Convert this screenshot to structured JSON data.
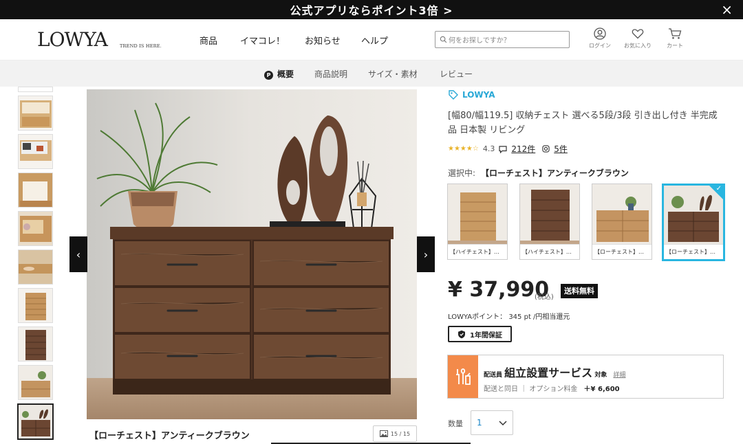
{
  "banner": {
    "text": "公式アプリならポイント3倍 >",
    "close": "×"
  },
  "header": {
    "logo": "LOWYA",
    "logo_sub": "TREND IS HERE.",
    "nav": [
      "商品",
      "イマコレ！",
      "お知らせ",
      "ヘルプ"
    ],
    "search_placeholder": "何をお探しですか？",
    "icons": [
      {
        "label": "ログイン",
        "icon": "user-icon"
      },
      {
        "label": "お気に入り",
        "icon": "heart-icon"
      },
      {
        "label": "カート",
        "icon": "cart-icon"
      }
    ]
  },
  "subnav": {
    "badge": "P",
    "items": [
      "概要",
      "商品説明",
      "サイズ・素材",
      "レビュー"
    ],
    "active_index": 0
  },
  "gallery": {
    "caption": "【ローチェスト】アンティークブラウン",
    "counter": "15 / 15",
    "prev": "‹",
    "next": "›",
    "active_thumb": 9
  },
  "product": {
    "brand": "LOWYA",
    "title": "[幅80/幅119.5] 収納チェスト 選べる5段/3段 引き出し付き 半完成品 日本製 リビング",
    "stars": "★★★★☆",
    "rating": "4.3",
    "review_count": "212件",
    "photo_count": "5件",
    "selected_prefix": "選択中:",
    "selected_name": "【ローチェスト】アンティークブラウン",
    "variants": [
      {
        "label": "【ハイチェスト】…",
        "selected": false
      },
      {
        "label": "【ハイチェスト】…",
        "selected": false
      },
      {
        "label": "【ローチェスト】…",
        "selected": false
      },
      {
        "label": "【ローチェスト】…",
        "selected": true
      }
    ],
    "check": "✓",
    "price": "¥ 37,990",
    "tax": "(税込)",
    "free_shipping": "送料無料",
    "points": "LOWYAポイント： 345 pt /円相当還元",
    "warranty": "1年間保証",
    "service": {
      "prefix": "配送員",
      "name": "組立設置サービス",
      "suffix": "対象",
      "detail": "詳細",
      "note": "配送と同日 ｜ オプション料金",
      "fee": "＋¥ 6,600"
    },
    "qty_label": "数量",
    "qty_value": "1"
  },
  "colors": {
    "accent": "#29a8d6",
    "service": "#f38a4a",
    "stars": "#e9b32a"
  }
}
